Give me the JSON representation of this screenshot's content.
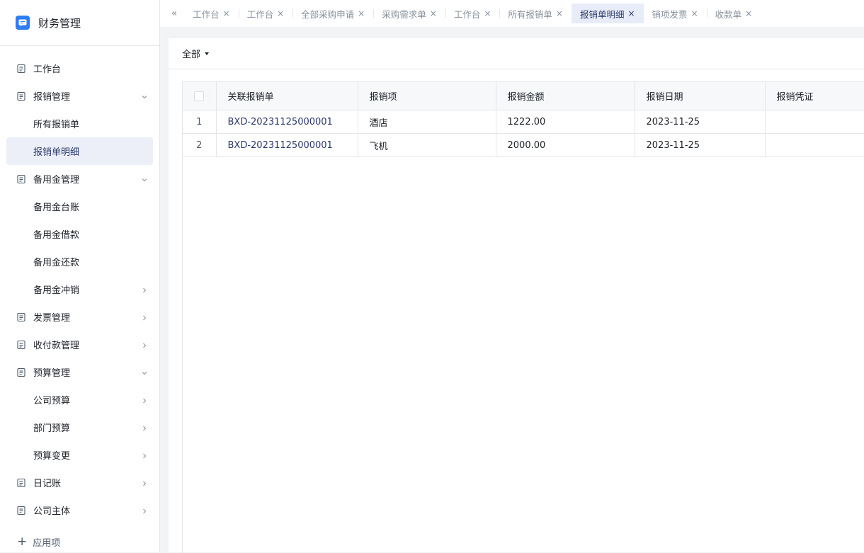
{
  "app": {
    "title": "财务管理",
    "logo_icon": "chat-icon",
    "brand_color": "#2f7cf6"
  },
  "sidebar": {
    "items": [
      {
        "label": "工作台",
        "level": 0,
        "icon": "document-icon",
        "arrow": "none",
        "active": false
      },
      {
        "label": "报销管理",
        "level": 0,
        "icon": "document-icon",
        "arrow": "down",
        "active": false
      },
      {
        "label": "所有报销单",
        "level": 1,
        "arrow": "none",
        "active": false
      },
      {
        "label": "报销单明细",
        "level": 1,
        "arrow": "none",
        "active": true
      },
      {
        "label": "备用金管理",
        "level": 0,
        "icon": "document-icon",
        "arrow": "down",
        "active": false
      },
      {
        "label": "备用金台账",
        "level": 1,
        "arrow": "none",
        "active": false
      },
      {
        "label": "备用金借款",
        "level": 1,
        "arrow": "none",
        "active": false
      },
      {
        "label": "备用金还款",
        "level": 1,
        "arrow": "none",
        "active": false
      },
      {
        "label": "备用金冲销",
        "level": 1,
        "arrow": "right",
        "active": false
      },
      {
        "label": "发票管理",
        "level": 0,
        "icon": "document-icon",
        "arrow": "right",
        "active": false
      },
      {
        "label": "收付款管理",
        "level": 0,
        "icon": "document-icon",
        "arrow": "right",
        "active": false
      },
      {
        "label": "预算管理",
        "level": 0,
        "icon": "document-icon",
        "arrow": "down",
        "active": false
      },
      {
        "label": "公司预算",
        "level": 1,
        "arrow": "right",
        "active": false
      },
      {
        "label": "部门预算",
        "level": 1,
        "arrow": "right",
        "active": false
      },
      {
        "label": "预算变更",
        "level": 1,
        "arrow": "right",
        "active": false
      },
      {
        "label": "日记账",
        "level": 0,
        "icon": "document-icon",
        "arrow": "right",
        "active": false
      },
      {
        "label": "公司主体",
        "level": 0,
        "icon": "document-icon",
        "arrow": "right",
        "active": false
      }
    ],
    "add_label": "应用项"
  },
  "tabs": {
    "collapse_glyph": "«",
    "items": [
      {
        "label": "工作台",
        "active": false
      },
      {
        "label": "工作台",
        "active": false
      },
      {
        "label": "全部采购申请",
        "active": false
      },
      {
        "label": "采购需求单",
        "active": false
      },
      {
        "label": "工作台",
        "active": false
      },
      {
        "label": "所有报销单",
        "active": false
      },
      {
        "label": "报销单明细",
        "active": true
      },
      {
        "label": "销项发票",
        "active": false
      },
      {
        "label": "收款单",
        "active": false
      }
    ]
  },
  "filter": {
    "label": "全部"
  },
  "table": {
    "columns": [
      "",
      "关联报销单",
      "报销项",
      "报销金额",
      "报销日期",
      "报销凭证"
    ],
    "rows": [
      {
        "index": "1",
        "bill": "BXD-20231125000001",
        "item": "酒店",
        "amount": "1222.00",
        "date": "2023-11-25",
        "voucher": ""
      },
      {
        "index": "2",
        "bill": "BXD-20231125000001",
        "item": "飞机",
        "amount": "2000.00",
        "date": "2023-11-25",
        "voucher": ""
      }
    ]
  }
}
